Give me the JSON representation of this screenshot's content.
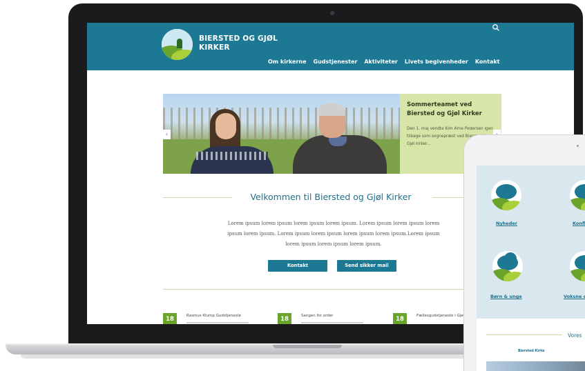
{
  "site": {
    "title": "BIERSTED OG GJØL KIRKER",
    "nav": [
      "Om kirkerne",
      "Gudstjenester",
      "Aktiviteter",
      "Livets begivenheder",
      "Kontakt"
    ]
  },
  "slider": {
    "title": "Sommerteamet ved Biersted og Gjøl Kirker",
    "body": "Den 1. maj vendte Kim Arne Pedersen igen tilbage som sognepræst ved Biersted og Gjøl kirker...",
    "prev": "‹",
    "next": "›"
  },
  "welcome": {
    "title": "Velkommen til Biersted og Gjøl Kirker",
    "text": "Lorem ipsum lorem ipsum lorem ipsum lorem ipsum. Lorem ipsum lorem ipsum lorem ipsum lorem ipsum. Lorem ipsum lorem ipsum lorem ipsum lorem ipsum.Lorem ipsum lorem ipsum lorem ipsum lorem ipsum.",
    "buttons": [
      "Kontakt",
      "Send sikker mail"
    ]
  },
  "events": [
    {
      "date": "18",
      "title": "Rasmus Klump Gudstjeneste"
    },
    {
      "date": "18",
      "title": "Sangen for order"
    },
    {
      "date": "18",
      "title": "Fællesgudstjeneste i Gjøl Kirke"
    }
  ],
  "tablet": {
    "links": [
      "Nyheder",
      "Konfir",
      "Børn & unge",
      "Voksne o"
    ],
    "heading": "Vores",
    "card_label": "Biersted Kirke"
  },
  "colors": {
    "header": "#1d7894",
    "accent_green": "#6aa42b",
    "slide_panel": "#d7e6a8",
    "tablet_panel": "#d9e8ef"
  }
}
